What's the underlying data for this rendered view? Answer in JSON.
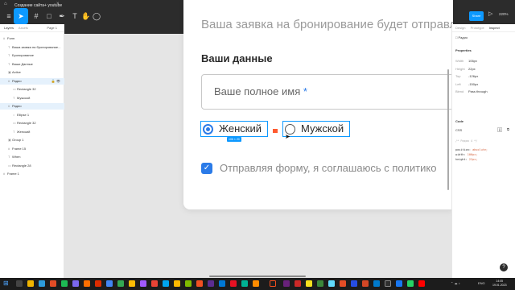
{
  "app": {
    "tab_title": "Создание сайта+ youtube",
    "zoom": "220%",
    "share_label": "Share"
  },
  "left_panel": {
    "tabs": [
      "Layers",
      "Assets"
    ],
    "page_label": "Page 1",
    "layers": [
      {
        "label": "Form",
        "indent": 1,
        "icon": "frame"
      },
      {
        "label": "Ваша заявка на бронирование...",
        "indent": 2,
        "icon": "text"
      },
      {
        "label": "Бронирование",
        "indent": 2,
        "icon": "text"
      },
      {
        "label": "Ваши Данные",
        "indent": 2,
        "icon": "text"
      },
      {
        "label": "Active",
        "indent": 2,
        "icon": "group"
      },
      {
        "label": "Радио",
        "indent": 2,
        "icon": "frame",
        "selected": true
      },
      {
        "label": "Rectangle 32",
        "indent": 3,
        "icon": "rect"
      },
      {
        "label": "Мужской",
        "indent": 3,
        "icon": "text"
      },
      {
        "label": "Радио",
        "indent": 2,
        "icon": "frame",
        "selected": true
      },
      {
        "label": "Ellipse 1",
        "indent": 3,
        "icon": "ellipse"
      },
      {
        "label": "Rectangle 32",
        "indent": 3,
        "icon": "rect"
      },
      {
        "label": "Женский",
        "indent": 3,
        "icon": "text"
      },
      {
        "label": "Group 1",
        "indent": 2,
        "icon": "group"
      },
      {
        "label": "Frame 15",
        "indent": 2,
        "icon": "frame"
      },
      {
        "label": "When",
        "indent": 2,
        "icon": "text"
      },
      {
        "label": "Rectangle 28",
        "indent": 2,
        "icon": "rect"
      },
      {
        "label": "Frame 1",
        "indent": 1,
        "icon": "frame"
      }
    ]
  },
  "canvas": {
    "top_text": "Ваша заявка на бронирование будет отправле",
    "heading": "Ваши данные",
    "name_placeholder": "Ваше полное имя",
    "required_mark": "*",
    "radio_female": "Женский",
    "radio_male": "Мужской",
    "size_badge": "106 × 20",
    "consent_text": "Отправляя форму, я соглашаюсь с политико"
  },
  "right_panel": {
    "tabs": [
      "Design",
      "Prototype",
      "Inspect"
    ],
    "active_tab": "Inspect",
    "selected_layer": "Радио",
    "properties_title": "Properties",
    "properties": [
      {
        "key": "Width",
        "value": "106px"
      },
      {
        "key": "Height",
        "value": "22px"
      },
      {
        "key": "Top",
        "value": "-126px"
      },
      {
        "key": "Left",
        "value": "-150px"
      },
      {
        "key": "Blend",
        "value": "Pass through"
      }
    ],
    "code_title": "Code",
    "code_lang": "CSS",
    "code_lines": [
      {
        "k": "/* Радио 4 */",
        "v": "",
        "comment": true
      },
      {
        "k": "position:",
        "v": "absolute;"
      },
      {
        "k": "width:",
        "v": "106px;"
      },
      {
        "k": "height:",
        "v": "22px;"
      }
    ]
  },
  "taskbar": {
    "lang": "ENG",
    "time": "14:05",
    "date": "19.01.2023"
  },
  "colors": {
    "accent": "#0d99ff",
    "checkbox_blue": "#2b7be8",
    "toolbar": "#2c2c2c"
  }
}
